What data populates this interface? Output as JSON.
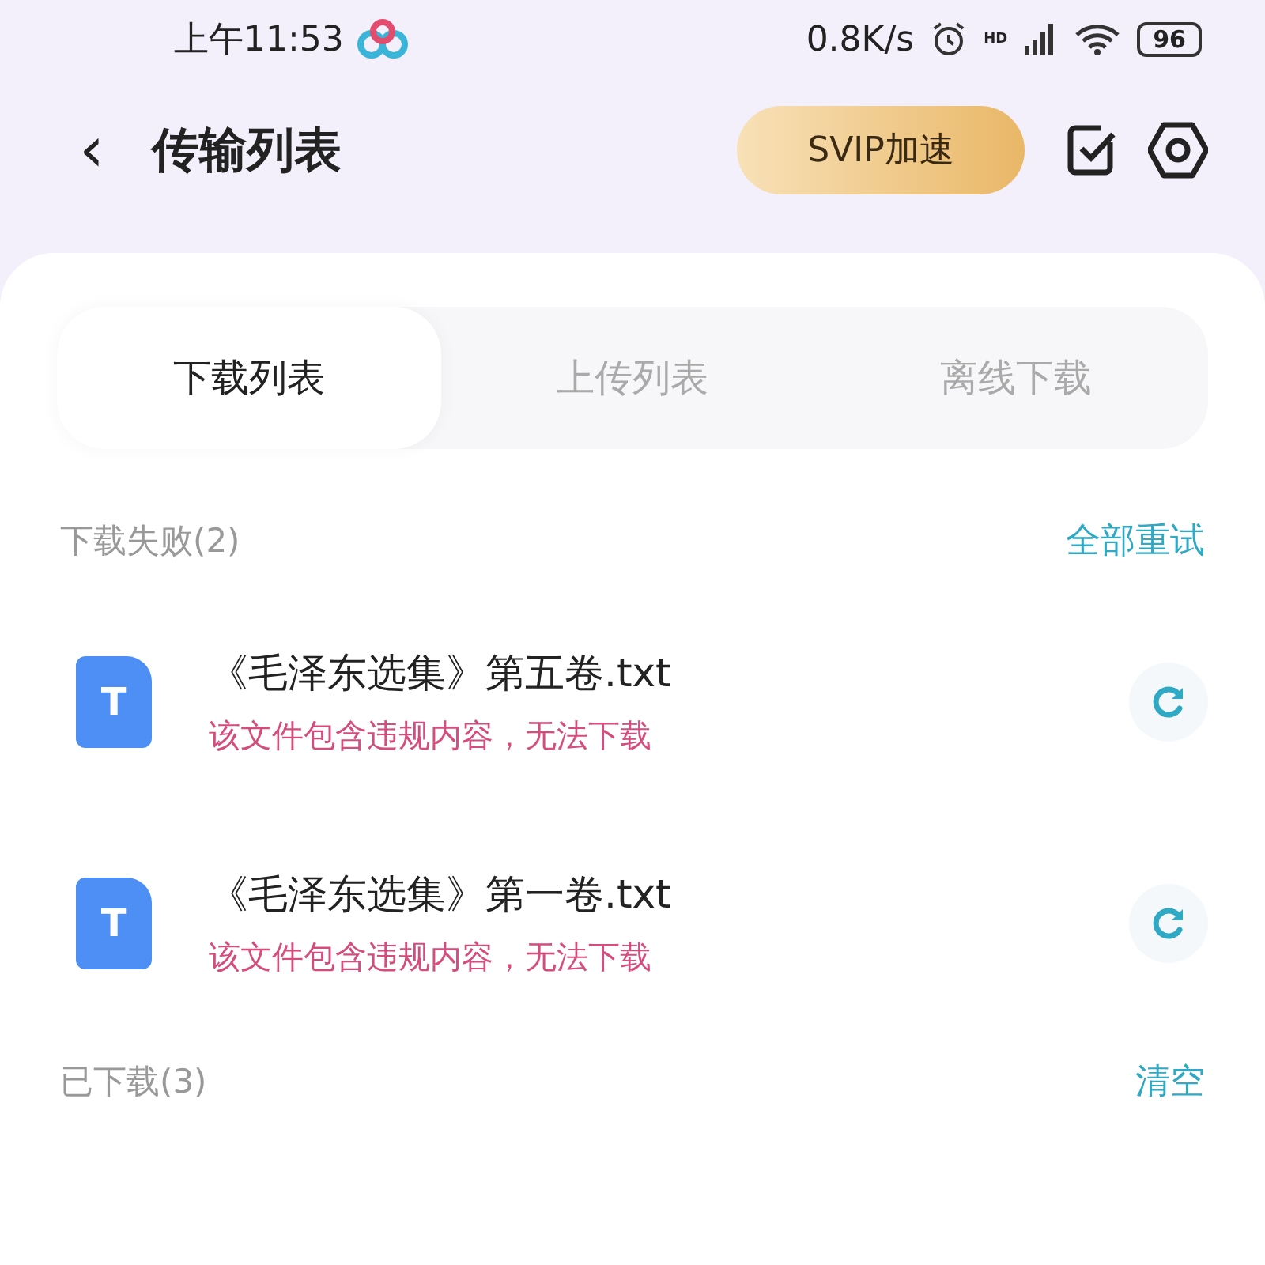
{
  "status_bar": {
    "time": "上午11:53",
    "speed": "0.8K/s",
    "network": "HD",
    "battery": "96"
  },
  "header": {
    "back": "‹",
    "title": "传输列表",
    "svip_button": "SVIP加速"
  },
  "tabs": [
    {
      "label": "下载列表",
      "selected": true
    },
    {
      "label": "上传列表",
      "selected": false
    },
    {
      "label": "离线下载",
      "selected": false
    }
  ],
  "sections": [
    {
      "title": "下载失败(2)",
      "action": "全部重试",
      "items": [
        {
          "icon_letter": "T",
          "name": "《毛泽东选集》第五卷.txt",
          "error": "该文件包含违规内容，无法下载"
        },
        {
          "icon_letter": "T",
          "name": "《毛泽东选集》第一卷.txt",
          "error": "该文件包含违规内容，无法下载"
        }
      ]
    },
    {
      "title": "已下载(3)",
      "action": "清空"
    }
  ]
}
